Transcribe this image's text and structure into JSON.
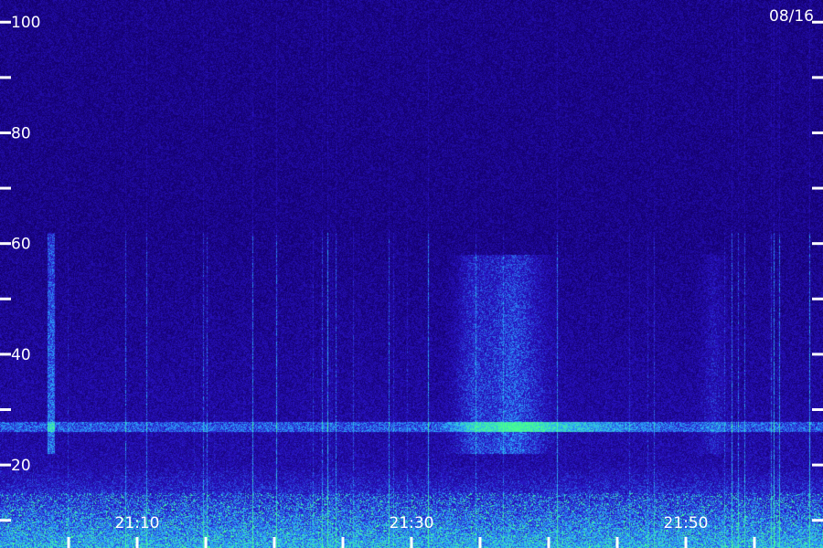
{
  "chart_data": {
    "type": "heatmap",
    "date_label": "08/16",
    "y_ticks": {
      "labeled": [
        20,
        40,
        60,
        80,
        100
      ],
      "labels": [
        "20",
        "40",
        "60",
        "80",
        "100"
      ],
      "unlabeled": [
        10,
        30,
        50,
        70,
        90
      ]
    },
    "ylim": [
      5,
      104
    ],
    "x_ticks": {
      "labeled": [
        "21:10",
        "21:30",
        "21:50"
      ],
      "minor_count": 12
    },
    "xlim_minutes": [
      "21:00",
      "22:00"
    ],
    "colors": {
      "background": "#14006e",
      "mid": "#2a3cd0",
      "bright": "#3fe0ff",
      "hot": "#40ff90"
    }
  }
}
